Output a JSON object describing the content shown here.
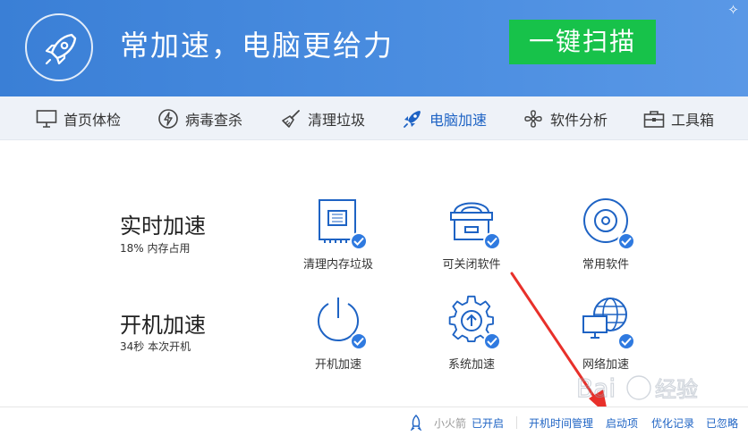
{
  "header": {
    "title": "常加速，电脑更给力",
    "scan_button": "一键扫描",
    "sparkle_icon": "sparkle-icon"
  },
  "nav": {
    "items": [
      {
        "label": "首页体检",
        "icon": "monitor-icon"
      },
      {
        "label": "病毒查杀",
        "icon": "lightning-circle-icon"
      },
      {
        "label": "清理垃圾",
        "icon": "broom-icon"
      },
      {
        "label": "电脑加速",
        "icon": "rocket-icon",
        "active": true
      },
      {
        "label": "软件分析",
        "icon": "fan-icon"
      },
      {
        "label": "工具箱",
        "icon": "toolbox-icon"
      }
    ]
  },
  "sections": {
    "realtime": {
      "title": "实时加速",
      "subtitle": "18% 内存占用"
    },
    "boot": {
      "title": "开机加速",
      "subtitle": "34秒 本次开机"
    }
  },
  "features": [
    {
      "label": "清理内存垃圾",
      "icon": "memory-chip-icon"
    },
    {
      "label": "可关闭软件",
      "icon": "software-box-icon"
    },
    {
      "label": "常用软件",
      "icon": "disc-icon"
    },
    {
      "label": "开机加速",
      "icon": "power-icon"
    },
    {
      "label": "系统加速",
      "icon": "gear-upload-icon"
    },
    {
      "label": "网络加速",
      "icon": "network-globe-icon"
    }
  ],
  "footer": {
    "rocket_label": "小火箭",
    "rocket_status": "已开启",
    "boot_time": "开机时间管理",
    "startup_items": "启动项",
    "optimize_log": "优化记录",
    "ignored": "已忽略"
  },
  "colors": {
    "header_blue": "#3a7fd6",
    "scan_green": "#17c24a",
    "accent_blue": "#1e63c4",
    "check_blue": "#2f7ae0",
    "arrow_red": "#e8302a"
  }
}
